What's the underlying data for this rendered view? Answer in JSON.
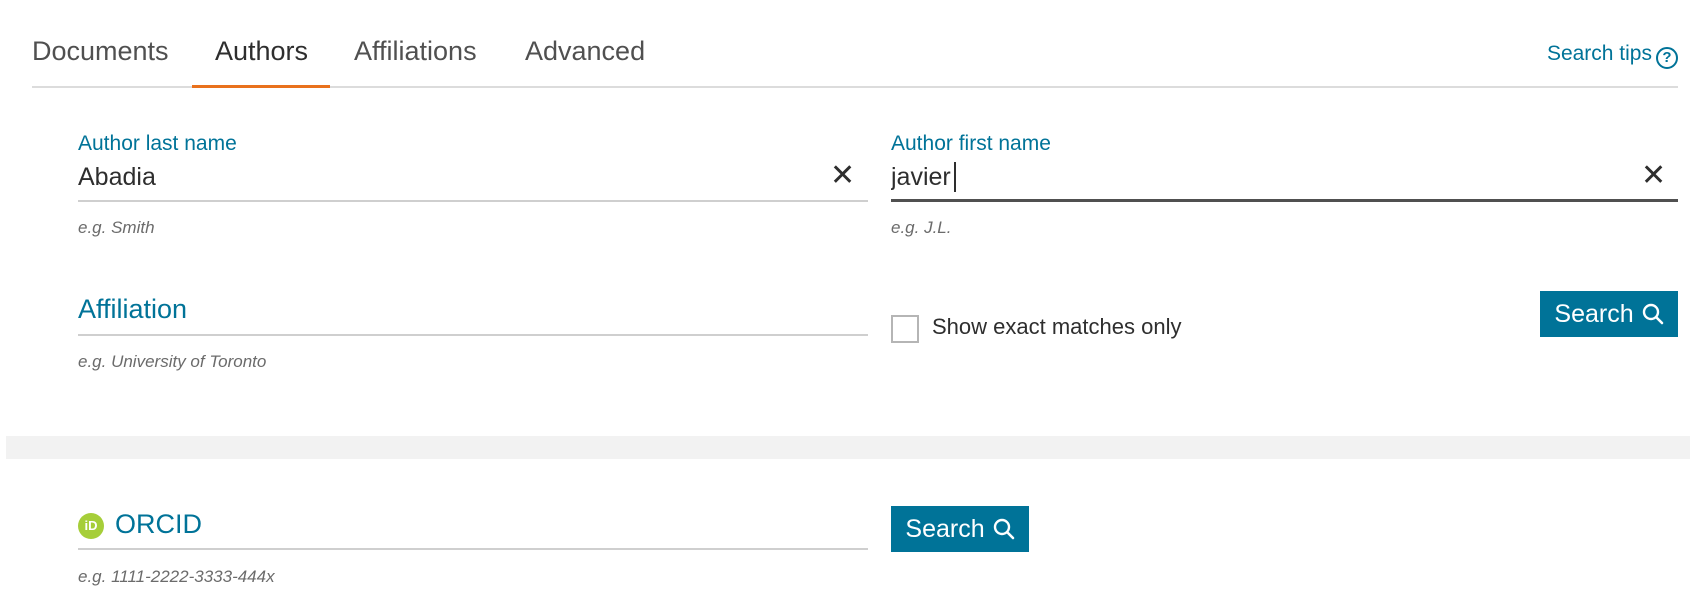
{
  "tabs": [
    {
      "label": "Documents"
    },
    {
      "label": "Authors"
    },
    {
      "label": "Affiliations"
    },
    {
      "label": "Advanced"
    }
  ],
  "active_tab": "Authors",
  "search_tips": {
    "label": "Search tips",
    "icon": "help-circle-icon"
  },
  "author_last_name": {
    "label": "Author last name",
    "value": "Abadia",
    "hint": "e.g. Smith"
  },
  "author_first_name": {
    "label": "Author first name",
    "value": "javier",
    "hint": "e.g. J.L."
  },
  "affiliation": {
    "placeholder": "Affiliation",
    "hint": "e.g. University of Toronto"
  },
  "exact_match": {
    "label": "Show exact matches only",
    "checked": false
  },
  "search_button": {
    "label": "Search",
    "icon": "search-icon"
  },
  "orcid": {
    "placeholder": "ORCID",
    "hint": "e.g. 1111-2222-3333-444x",
    "icon_text": "iD"
  },
  "orcid_search_button": {
    "label": "Search",
    "icon": "search-icon"
  },
  "colors": {
    "accent": "#007398",
    "tab_underline": "#e9711c",
    "orcid_green": "#a6ce39"
  }
}
